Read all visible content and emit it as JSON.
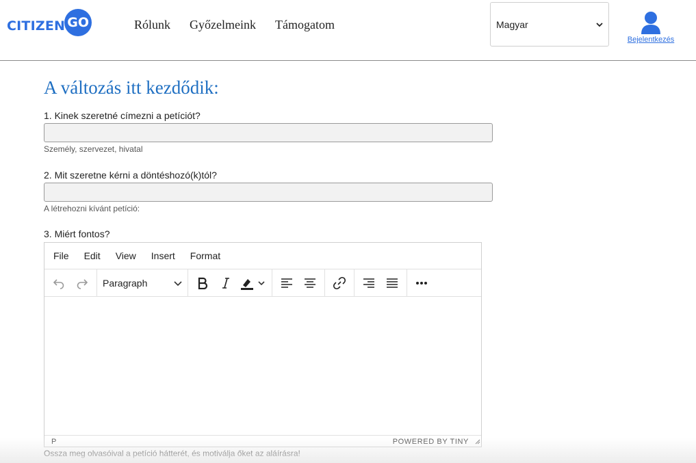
{
  "header": {
    "logo": {
      "text_left": "CITIZEN",
      "text_circle": "GO",
      "color": "#2e6fe0"
    },
    "nav": [
      "Rólunk",
      "Győzelmeink",
      "Támogatom"
    ],
    "language": {
      "selected": "Magyar"
    },
    "user": {
      "icon": "user-icon",
      "login_label": "Bejelentkezés"
    }
  },
  "form": {
    "title": "A változás itt kezdődik:",
    "q1": {
      "label": "1. Kinek szeretné címezni a petíciót?",
      "value": "",
      "hint": "Személy, szervezet, hivatal"
    },
    "q2": {
      "label": "2. Mit szeretne kérni a döntéshozó(k)tól?",
      "value": "",
      "hint": "A létrehozni kívánt petíció:"
    },
    "q3": {
      "label": "3. Miért fontos?",
      "menu": [
        "File",
        "Edit",
        "View",
        "Insert",
        "Format"
      ],
      "block_format": "Paragraph",
      "toolbar_icons": [
        "undo-icon",
        "redo-icon",
        "bold-icon",
        "italic-icon",
        "highlight-icon",
        "align-left-icon",
        "align-center-icon",
        "link-icon",
        "align-right-icon",
        "justify-icon",
        "more-icon"
      ],
      "status_path": "P",
      "powered_by": "POWERED BY TINY",
      "hint": "Ossza meg olvasóival a petíció hátterét, és motiválja őket az aláírásra!"
    }
  }
}
